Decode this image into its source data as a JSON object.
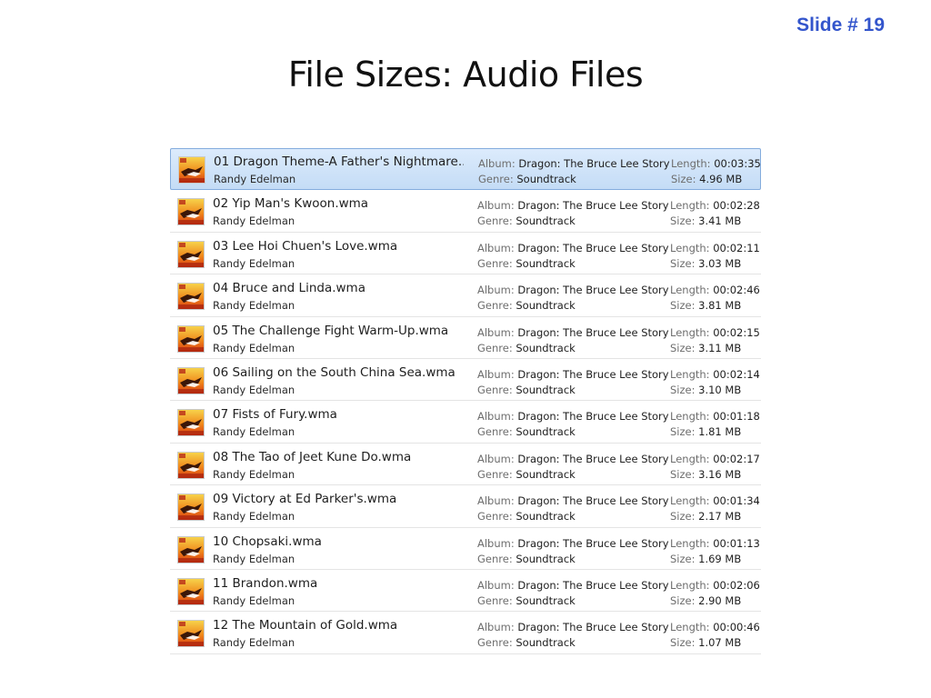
{
  "slide_number": "Slide # 19",
  "title": "File Sizes: Audio Files",
  "labels": {
    "album": "Album:",
    "genre": "Genre:",
    "length": "Length:",
    "size": "Size:"
  },
  "files": [
    {
      "name": "01 Dragon Theme-A Father's Nightmare....",
      "artist": "Randy Edelman",
      "album": "Dragon: The Bruce Lee Story",
      "genre": "Soundtrack",
      "length": "00:03:35",
      "size": "4.96 MB",
      "selected": true
    },
    {
      "name": "02 Yip Man's Kwoon.wma",
      "artist": "Randy Edelman",
      "album": "Dragon: The Bruce Lee Story",
      "genre": "Soundtrack",
      "length": "00:02:28",
      "size": "3.41 MB"
    },
    {
      "name": "03 Lee Hoi Chuen's Love.wma",
      "artist": "Randy Edelman",
      "album": "Dragon: The Bruce Lee Story",
      "genre": "Soundtrack",
      "length": "00:02:11",
      "size": "3.03 MB"
    },
    {
      "name": "04 Bruce and Linda.wma",
      "artist": "Randy Edelman",
      "album": "Dragon: The Bruce Lee Story",
      "genre": "Soundtrack",
      "length": "00:02:46",
      "size": "3.81 MB"
    },
    {
      "name": "05 The Challenge Fight Warm-Up.wma",
      "artist": "Randy Edelman",
      "album": "Dragon: The Bruce Lee Story",
      "genre": "Soundtrack",
      "length": "00:02:15",
      "size": "3.11 MB"
    },
    {
      "name": "06 Sailing on the South China Sea.wma",
      "artist": "Randy Edelman",
      "album": "Dragon: The Bruce Lee Story",
      "genre": "Soundtrack",
      "length": "00:02:14",
      "size": "3.10 MB"
    },
    {
      "name": "07 Fists of Fury.wma",
      "artist": "Randy Edelman",
      "album": "Dragon: The Bruce Lee Story",
      "genre": "Soundtrack",
      "length": "00:01:18",
      "size": "1.81 MB"
    },
    {
      "name": "08 The Tao of Jeet Kune Do.wma",
      "artist": "Randy Edelman",
      "album": "Dragon: The Bruce Lee Story",
      "genre": "Soundtrack",
      "length": "00:02:17",
      "size": "3.16 MB"
    },
    {
      "name": "09 Victory at Ed Parker's.wma",
      "artist": "Randy Edelman",
      "album": "Dragon: The Bruce Lee Story",
      "genre": "Soundtrack",
      "length": "00:01:34",
      "size": "2.17 MB"
    },
    {
      "name": "10 Chopsaki.wma",
      "artist": "Randy Edelman",
      "album": "Dragon: The Bruce Lee Story",
      "genre": "Soundtrack",
      "length": "00:01:13",
      "size": "1.69 MB"
    },
    {
      "name": "11 Brandon.wma",
      "artist": "Randy Edelman",
      "album": "Dragon: The Bruce Lee Story",
      "genre": "Soundtrack",
      "length": "00:02:06",
      "size": "2.90 MB"
    },
    {
      "name": "12 The Mountain of Gold.wma",
      "artist": "Randy Edelman",
      "album": "Dragon: The Bruce Lee Story",
      "genre": "Soundtrack",
      "length": "00:00:46",
      "size": "1.07 MB"
    }
  ],
  "icon": "album-art-icon",
  "colors": {
    "slide_number": "#3355cc",
    "selected_row": "#cfe3fa",
    "label": "#6e6e6e"
  }
}
